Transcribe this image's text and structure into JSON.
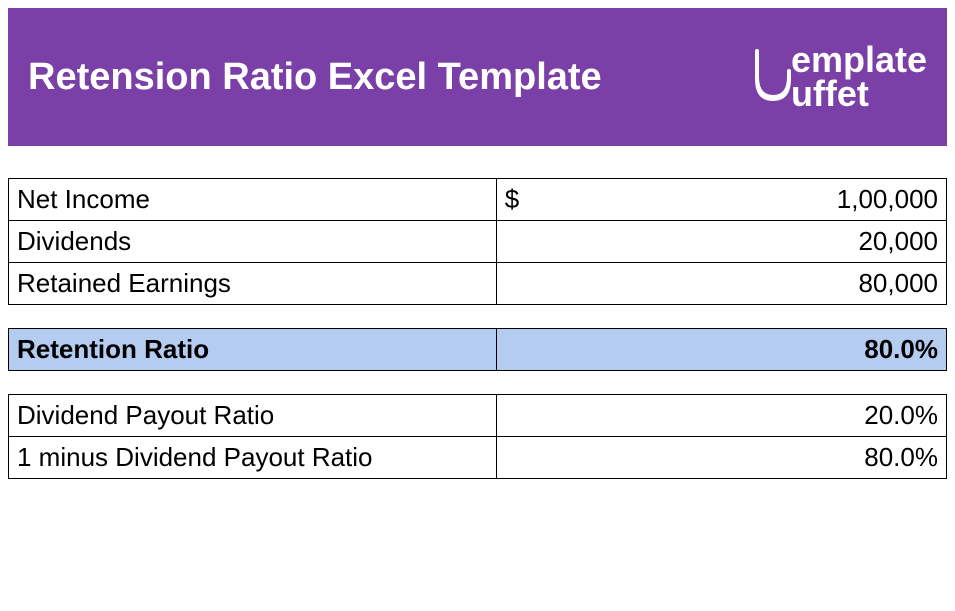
{
  "header": {
    "title": "Retension Ratio Excel Template",
    "logo": {
      "line1": "emplate",
      "line2": "uffet"
    }
  },
  "rows": {
    "net_income": {
      "label": "Net Income",
      "currency": "$",
      "value": "1,00,000"
    },
    "dividends": {
      "label": "Dividends",
      "value": "20,000"
    },
    "retained_earnings": {
      "label": "Retained Earnings",
      "value": "80,000"
    },
    "retention_ratio": {
      "label": "Retention Ratio",
      "value": "80.0%"
    },
    "dividend_payout": {
      "label": "Dividend Payout Ratio",
      "value": "20.0%"
    },
    "one_minus_payout": {
      "label": "1 minus Dividend Payout Ratio",
      "value": "80.0%"
    }
  }
}
